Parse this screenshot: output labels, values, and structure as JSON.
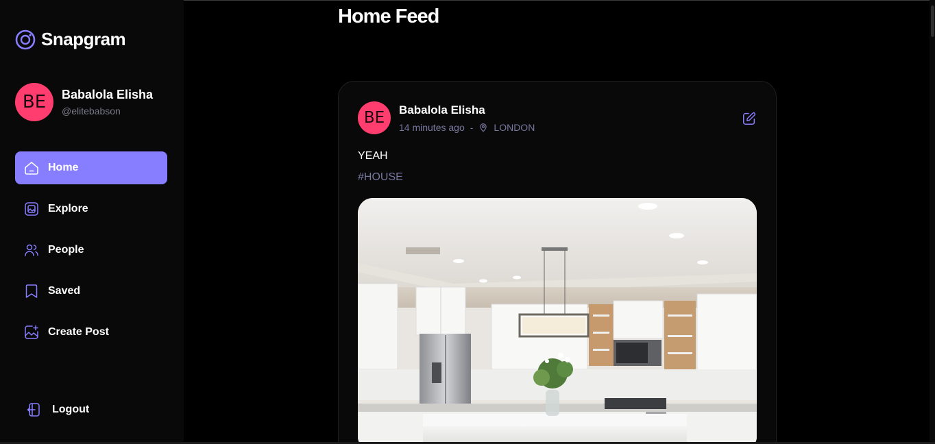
{
  "brand": {
    "name": "Snapgram",
    "accent": "#877eff"
  },
  "user": {
    "initials": "BE",
    "name": "Babalola Elisha",
    "handle": "@elitebabson",
    "avatar_color": "#ff3d6e"
  },
  "nav": {
    "items": [
      {
        "label": "Home",
        "icon": "home-icon",
        "active": true
      },
      {
        "label": "Explore",
        "icon": "gallery-icon",
        "active": false
      },
      {
        "label": "People",
        "icon": "people-icon",
        "active": false
      },
      {
        "label": "Saved",
        "icon": "bookmark-icon",
        "active": false
      },
      {
        "label": "Create Post",
        "icon": "image-add-icon",
        "active": false
      }
    ],
    "logout_label": "Logout"
  },
  "page": {
    "title": "Home Feed"
  },
  "post": {
    "author": "Babalola Elisha",
    "initials": "BE",
    "time": "14 minutes ago",
    "separator": "-",
    "location": "LONDON",
    "caption": "YEAH",
    "tags": "#HOUSE",
    "image_alt": "white kitchen interior with pendant light and flower vase"
  }
}
